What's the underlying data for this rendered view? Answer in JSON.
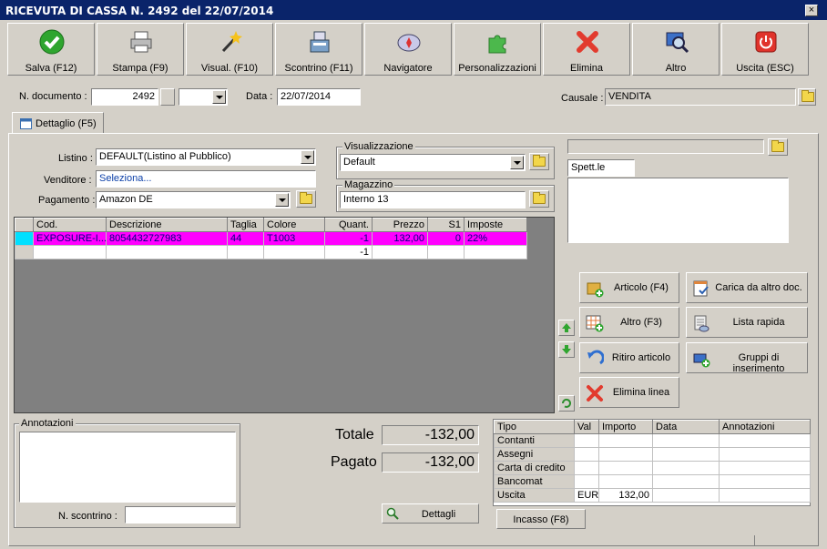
{
  "window": {
    "title": "RICEVUTA DI CASSA N. 2492 del 22/07/2014",
    "close_glyph": "×"
  },
  "toolbar": [
    {
      "label": "Salva (F12)",
      "icon": "check-icon"
    },
    {
      "label": "Stampa (F9)",
      "icon": "printer-icon"
    },
    {
      "label": "Visual. (F10)",
      "icon": "magic-wand-icon"
    },
    {
      "label": "Scontrino (F11)",
      "icon": "cash-register-icon"
    },
    {
      "label": "Navigatore",
      "icon": "compass-icon"
    },
    {
      "label": "Personalizzazioni",
      "icon": "puzzle-icon"
    },
    {
      "label": "Elimina",
      "icon": "delete-x-icon"
    },
    {
      "label": "Altro",
      "icon": "magnifier-icon"
    },
    {
      "label": "Uscita (ESC)",
      "icon": "power-icon"
    }
  ],
  "header": {
    "doc_label": "N. documento :",
    "doc_number": "2492",
    "doc_suffix": "",
    "date_label": "Data :",
    "date": "22/07/2014",
    "causale_label": "Causale :",
    "causale": "VENDITA"
  },
  "tab": {
    "label": "Dettaglio (F5)"
  },
  "form": {
    "listino_label": "Listino :",
    "listino": "DEFAULT(Listino al Pubblico)",
    "venditore_label": "Venditore :",
    "venditore": "Seleziona...",
    "pagamento_label": "Pagamento :",
    "pagamento": "Amazon DE",
    "visual_group": "Visualizzazione",
    "visual_value": "Default",
    "magazzino_group": "Magazzino",
    "magazzino_value": "Interno 13",
    "customer_top": "",
    "customer_name": "Spett.le",
    "customer_address": ""
  },
  "grid": {
    "columns": [
      "Cod.",
      "Descrizione",
      "Taglia",
      "Colore",
      "Quant.",
      "Prezzo",
      "S1",
      "Imposte"
    ],
    "rows": [
      [
        "EXPOSURE-I...",
        "8054432727983",
        "44",
        "T1003",
        "-1",
        "132,00",
        "0",
        "22%"
      ],
      [
        "",
        "",
        "",
        "",
        "-1",
        "",
        "",
        ""
      ]
    ]
  },
  "actions": {
    "articolo": "Articolo (F4)",
    "carica": "Carica da altro doc.",
    "altro": "Altro (F3)",
    "lista": "Lista rapida",
    "ritiro": "Ritiro articolo",
    "gruppi": "Gruppi di inserimentο",
    "elimina": "Elimina linea"
  },
  "notes": {
    "label": "Annotazioni",
    "scontrino_label": "N. scontrino :",
    "scontrino": ""
  },
  "totals": {
    "totale_label": "Totale",
    "totale": "-132,00",
    "pagato_label": "Pagato",
    "pagato": "-132,00",
    "dettagli": "Dettagli"
  },
  "payments": {
    "columns": [
      "Tipo",
      "Val",
      "Importo",
      "Data",
      "Annotazioni"
    ],
    "rows": [
      [
        "Contanti",
        "",
        "",
        "",
        ""
      ],
      [
        "Assegni",
        "",
        "",
        "",
        ""
      ],
      [
        "Carta di credito",
        "",
        "",
        "",
        ""
      ],
      [
        "Bancomat",
        "",
        "",
        "",
        ""
      ],
      [
        "Uscita",
        "EUR",
        "132,00",
        "",
        ""
      ]
    ],
    "incasso": "Incasso (F8)"
  },
  "colors": {
    "title_bg": "#0a246a",
    "row_highlight": "#ff00ff",
    "grid_bg": "#808080"
  }
}
